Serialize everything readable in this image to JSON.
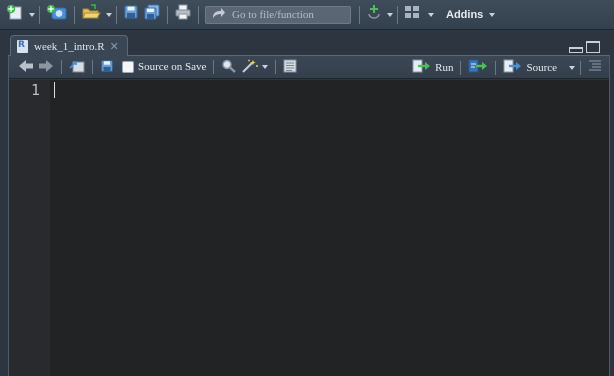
{
  "main_toolbar": {
    "goto_placeholder": "Go to file/function",
    "addins_label": "Addins"
  },
  "editor": {
    "tab": {
      "filename": "week_1_intro.R"
    },
    "toolbar": {
      "source_on_save_label": "Source on Save",
      "run_label": "Run",
      "source_label": "Source"
    },
    "line_numbers": [
      "1"
    ]
  },
  "icons": {
    "new_file": "new-file-icon",
    "new_project": "new-project-icon",
    "open_folder": "open-folder-icon",
    "save": "save-icon",
    "save_all": "save-all-icon",
    "print": "print-icon",
    "goto_arrow": "goto-arrow-icon",
    "version_control": "version-control-icon",
    "workspace_panes": "workspace-panes-icon"
  },
  "colors": {
    "toolbar_bg": "#3a4754",
    "editor_bg": "#212325",
    "gutter_bg": "#282a2e",
    "accent_green": "#4cbf5a",
    "accent_blue": "#4b8ed6"
  }
}
